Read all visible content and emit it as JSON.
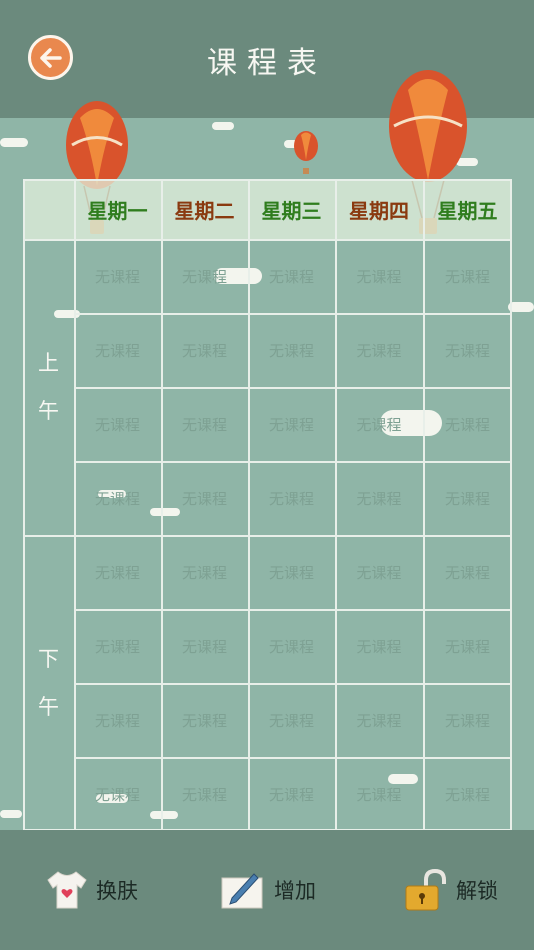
{
  "header": {
    "title": "课程表",
    "back_icon": "back-arrow-icon"
  },
  "timetable": {
    "days": [
      {
        "label": "星期一",
        "color": "#2f7d1e"
      },
      {
        "label": "星期二",
        "color": "#8a3a10"
      },
      {
        "label": "星期三",
        "color": "#2f7d1e"
      },
      {
        "label": "星期四",
        "color": "#8a3a10"
      },
      {
        "label": "星期五",
        "color": "#2f7d1e"
      }
    ],
    "morning": [
      "上",
      "午"
    ],
    "afternoon": [
      "下",
      "午"
    ],
    "empty_label": "无课程",
    "rows": 8
  },
  "footer": {
    "skin": {
      "label": "换肤",
      "icon": "tshirt-icon"
    },
    "add": {
      "label": "增加",
      "icon": "pen-paper-icon"
    },
    "unlock": {
      "label": "解锁",
      "icon": "padlock-icon"
    }
  },
  "colors": {
    "header_bg": "#6b8a7d",
    "sky_bg": "#8fb5a7",
    "accent": "#e9884e"
  }
}
